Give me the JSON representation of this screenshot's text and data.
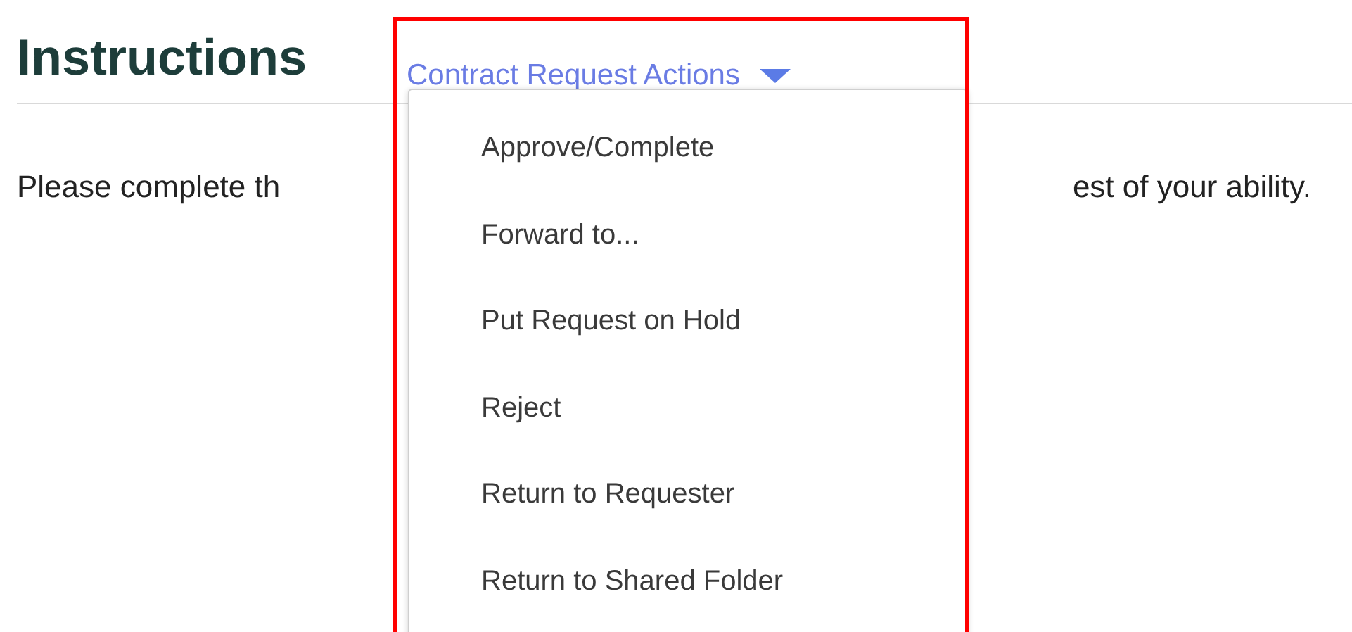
{
  "heading": "Instructions",
  "actions_menu": {
    "label": "Contract Request Actions",
    "expanded": true,
    "highlighted": true,
    "items": [
      "Approve/Complete",
      "Forward to...",
      "Put Request on Hold",
      "Reject",
      "Return to Requester",
      "Return to Shared Folder"
    ]
  },
  "paragraph_parts": [
    "Please complete th",
    "est of your ability."
  ]
}
